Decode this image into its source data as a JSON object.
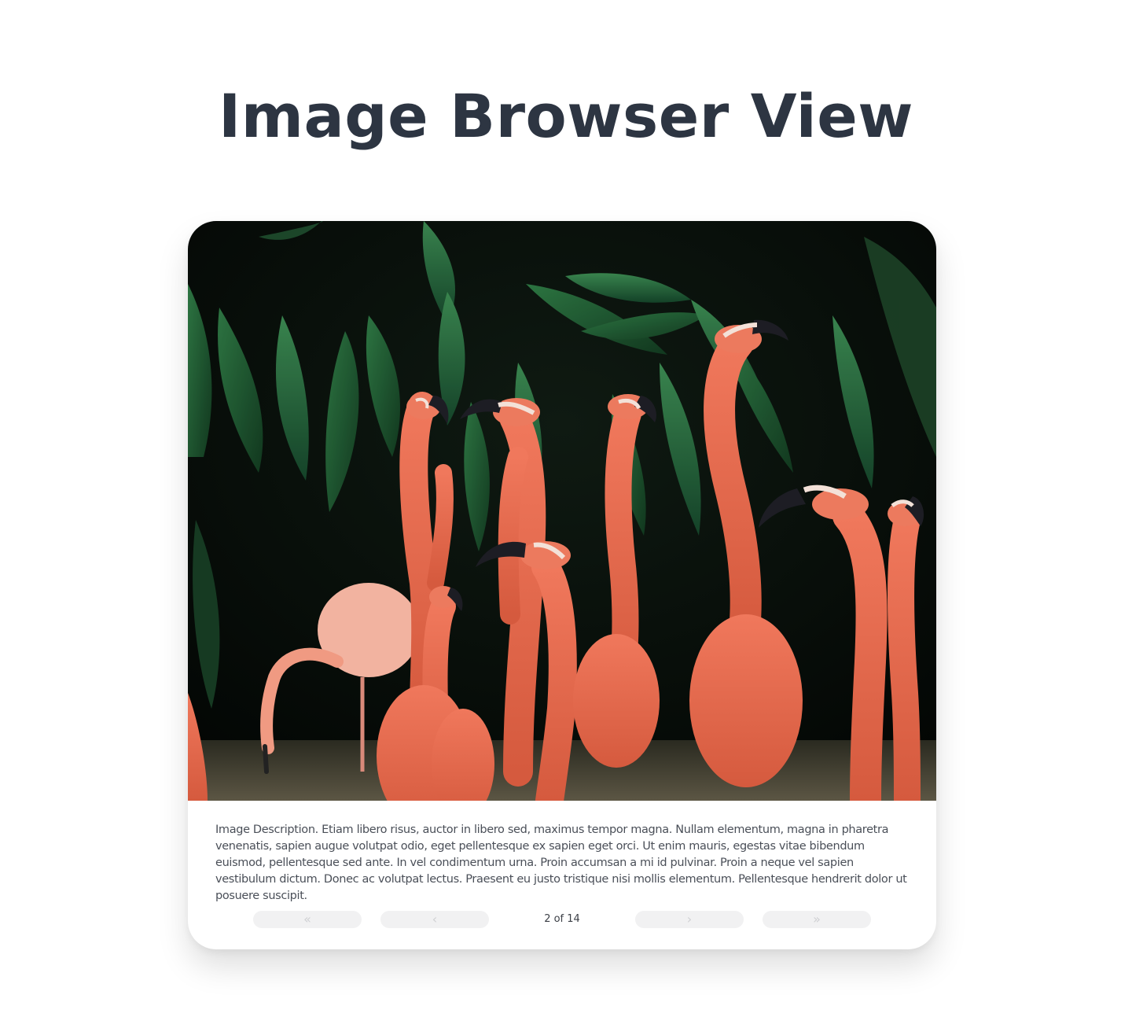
{
  "page": {
    "title": "Image Browser View"
  },
  "viewer": {
    "image_alt": "Flamingos standing in front of tropical foliage",
    "description": "Image Description. Etiam libero risus, auctor in libero sed, maximus tempor magna. Nullam elementum, magna in pharetra venenatis, sapien augue volutpat odio, eget pellentesque ex sapien eget orci. Ut enim mauris, egestas vitae bibendum euismod, pellentesque sed ante. In vel condimentum urna. Proin accumsan a mi id pulvinar. Proin a neque vel sapien vestibulum dictum. Donec ac volutpat lectus. Praesent eu justo tristique nisi mollis elementum. Pellentesque hendrerit dolor ut posuere suscipit."
  },
  "pagination": {
    "status": "2 of 14",
    "first_glyph": "«",
    "prev_glyph": "‹",
    "next_glyph": "›",
    "last_glyph": "»"
  },
  "colors": {
    "title": "#2d3542",
    "text": "#4a4f58",
    "button_bg": "#f1f1f2",
    "button_glyph": "#cfd0d3",
    "flamingo": "#e8654a",
    "foliage": "#1f5a33"
  },
  "icons": {
    "first": "double-chevron-left-icon",
    "prev": "chevron-left-icon",
    "next": "chevron-right-icon",
    "last": "double-chevron-right-icon"
  }
}
